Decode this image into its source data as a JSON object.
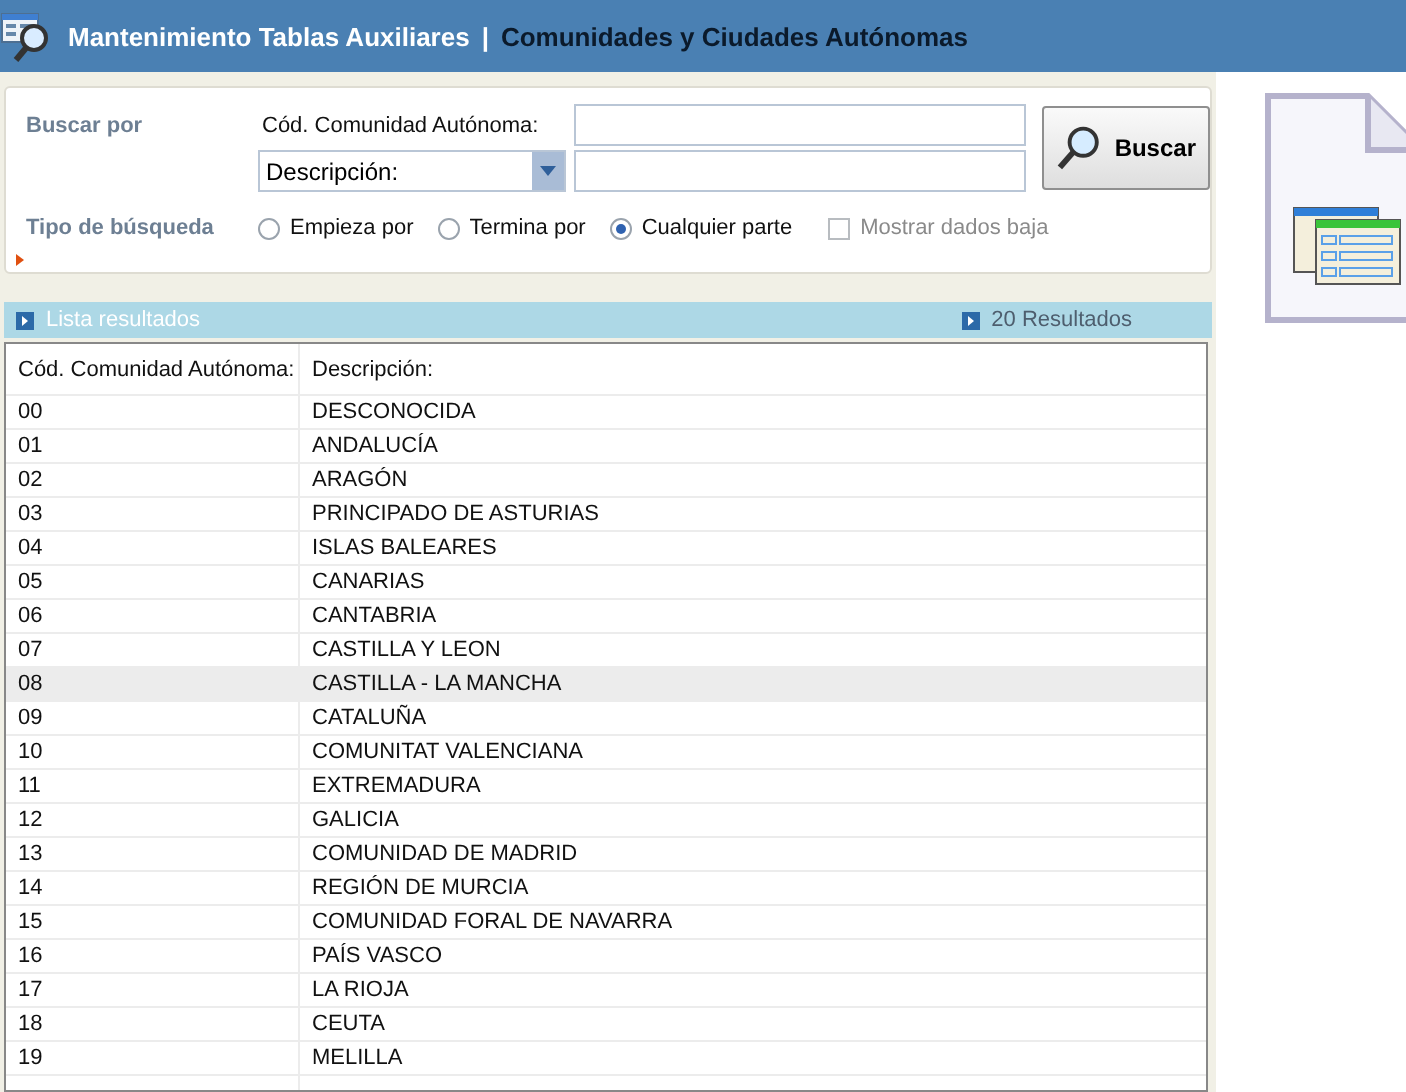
{
  "header": {
    "section": "Mantenimiento Tablas Auxiliares",
    "separator": "|",
    "title": "Comunidades y Ciudades Autónomas"
  },
  "search": {
    "label": "Buscar por",
    "field1_label": "Cód. Comunidad Autónoma:",
    "field2_select": "Descripción:",
    "button": "Buscar",
    "type_label": "Tipo de búsqueda",
    "options": [
      {
        "label": "Empieza por",
        "selected": false
      },
      {
        "label": "Termina por",
        "selected": false
      },
      {
        "label": "Cualquier parte",
        "selected": true
      }
    ],
    "show_deleted": {
      "label": "Mostrar dados baja",
      "checked": false,
      "disabled": true
    }
  },
  "results_bar": {
    "title": "Lista resultados",
    "count": "20 Resultados"
  },
  "table": {
    "columns": [
      "Cód. Comunidad Autónoma:",
      "Descripción:"
    ],
    "rows": [
      {
        "cells": [
          "00",
          "DESCONOCIDA"
        ],
        "selected": false
      },
      {
        "cells": [
          "01",
          "ANDALUCÍA"
        ],
        "selected": false
      },
      {
        "cells": [
          "02",
          "ARAGÓN"
        ],
        "selected": false
      },
      {
        "cells": [
          "03",
          "PRINCIPADO DE ASTURIAS"
        ],
        "selected": false
      },
      {
        "cells": [
          "04",
          "ISLAS BALEARES"
        ],
        "selected": false
      },
      {
        "cells": [
          "05",
          "CANARIAS"
        ],
        "selected": false
      },
      {
        "cells": [
          "06",
          "CANTABRIA"
        ],
        "selected": false
      },
      {
        "cells": [
          "07",
          "CASTILLA Y LEON"
        ],
        "selected": false
      },
      {
        "cells": [
          "08",
          "CASTILLA - LA MANCHA"
        ],
        "selected": true
      },
      {
        "cells": [
          "09",
          "CATALUÑA"
        ],
        "selected": false
      },
      {
        "cells": [
          "10",
          "COMUNITAT VALENCIANA"
        ],
        "selected": false
      },
      {
        "cells": [
          "11",
          "EXTREMADURA"
        ],
        "selected": false
      },
      {
        "cells": [
          "12",
          "GALICIA"
        ],
        "selected": false
      },
      {
        "cells": [
          "13",
          "COMUNIDAD DE MADRID"
        ],
        "selected": false
      },
      {
        "cells": [
          "14",
          "REGIÓN DE MURCIA"
        ],
        "selected": false
      },
      {
        "cells": [
          "15",
          "COMUNIDAD FORAL DE NAVARRA"
        ],
        "selected": false
      },
      {
        "cells": [
          "16",
          "PAÍS VASCO"
        ],
        "selected": false
      },
      {
        "cells": [
          "17",
          "LA RIOJA"
        ],
        "selected": false
      },
      {
        "cells": [
          "18",
          "CEUTA"
        ],
        "selected": false
      },
      {
        "cells": [
          "19",
          "MELILLA"
        ],
        "selected": false
      }
    ]
  }
}
